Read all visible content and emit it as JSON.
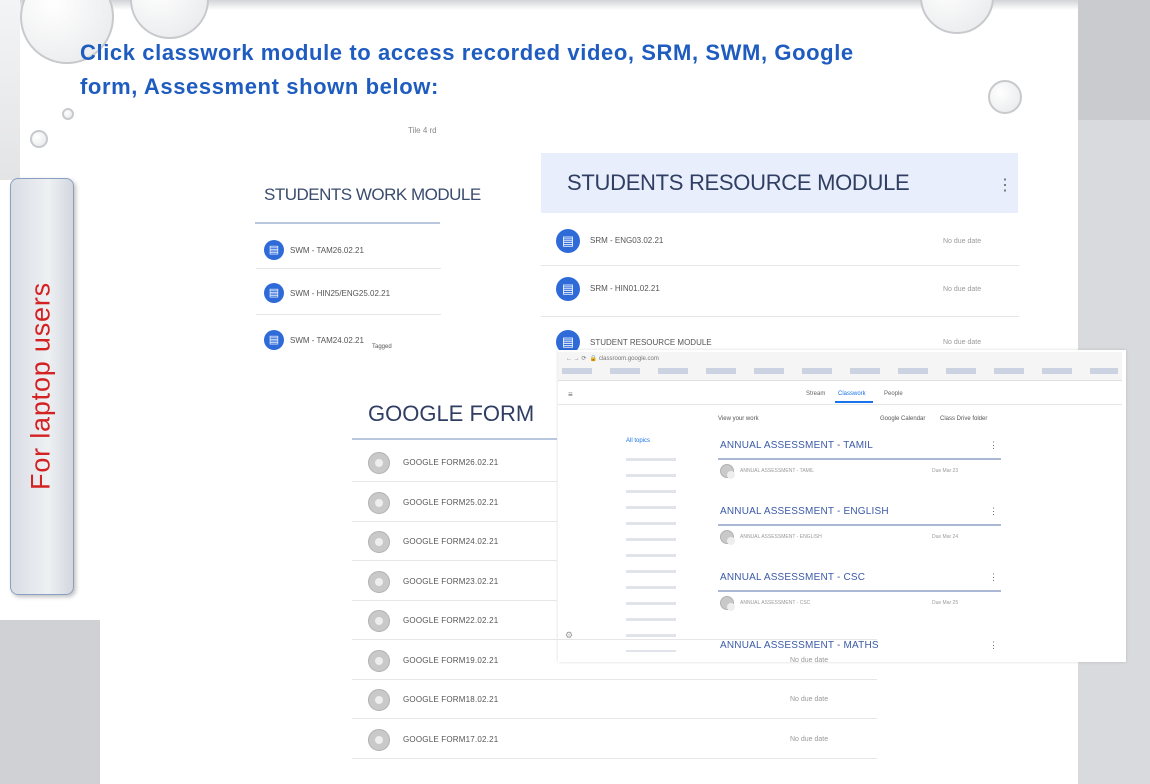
{
  "slide": {
    "heading_line1": "Click classwork module to access recorded video, SRM, SWM, Google",
    "heading_line2": "form, Assessment shown below:",
    "side_label": "For laptop users",
    "colors": {
      "heading": "#1f5cc0",
      "side_label": "#d42222",
      "accent_blue": "#2e6bd8"
    }
  },
  "swm": {
    "top_label": "Tile 4 rd",
    "title": "STUDENTS WORK MODULE",
    "items": [
      {
        "label": "SWM - TAM26.02.21"
      },
      {
        "label": "SWM - HIN25/ENG25.02.21"
      },
      {
        "label": "SWM - TAM24.02.21"
      }
    ],
    "cursor_label": "Tagged"
  },
  "srm": {
    "title": "STUDENTS RESOURCE MODULE",
    "items": [
      {
        "label": "SRM - ENG03.02.21",
        "meta": "No due date"
      },
      {
        "label": "SRM - HIN01.02.21",
        "meta": "No due date"
      },
      {
        "label": "STUDENT RESOURCE MODULE",
        "meta": "No due date"
      }
    ]
  },
  "google_form": {
    "title": "GOOGLE FORM",
    "items": [
      {
        "label": "GOOGLE FORM26.02.21",
        "meta": ""
      },
      {
        "label": "GOOGLE FORM25.02.21",
        "meta": ""
      },
      {
        "label": "GOOGLE FORM24.02.21",
        "meta": ""
      },
      {
        "label": "GOOGLE FORM23.02.21",
        "meta": ""
      },
      {
        "label": "GOOGLE FORM22.02.21",
        "meta": ""
      },
      {
        "label": "GOOGLE FORM19.02.21",
        "meta": "No due date"
      },
      {
        "label": "GOOGLE FORM18.02.21",
        "meta": "No due date"
      },
      {
        "label": "GOOGLE FORM17.02.21",
        "meta": "No due date"
      }
    ]
  },
  "classroom": {
    "tabs": [
      "Stream",
      "Classwork",
      "People"
    ],
    "left_nav_header": "All topics",
    "toolbar_left": "View your work",
    "toolbar_mid": "Google Calendar",
    "toolbar_right": "Class Drive folder",
    "assessments": [
      {
        "title": "ANNUAL ASSESSMENT - TAMIL",
        "item": "ANNUAL ASSESSMENT - TAMIL",
        "meta": "Due Mar 23"
      },
      {
        "title": "ANNUAL ASSESSMENT - ENGLISH",
        "item": "ANNUAL ASSESSMENT - ENGLISH",
        "meta": "Due Mar 24"
      },
      {
        "title": "ANNUAL ASSESSMENT - CSC",
        "item": "ANNUAL ASSESSMENT - CSC",
        "meta": "Due Mar 25"
      },
      {
        "title": "ANNUAL ASSESSMENT - MATHS",
        "item": "",
        "meta": ""
      }
    ]
  }
}
